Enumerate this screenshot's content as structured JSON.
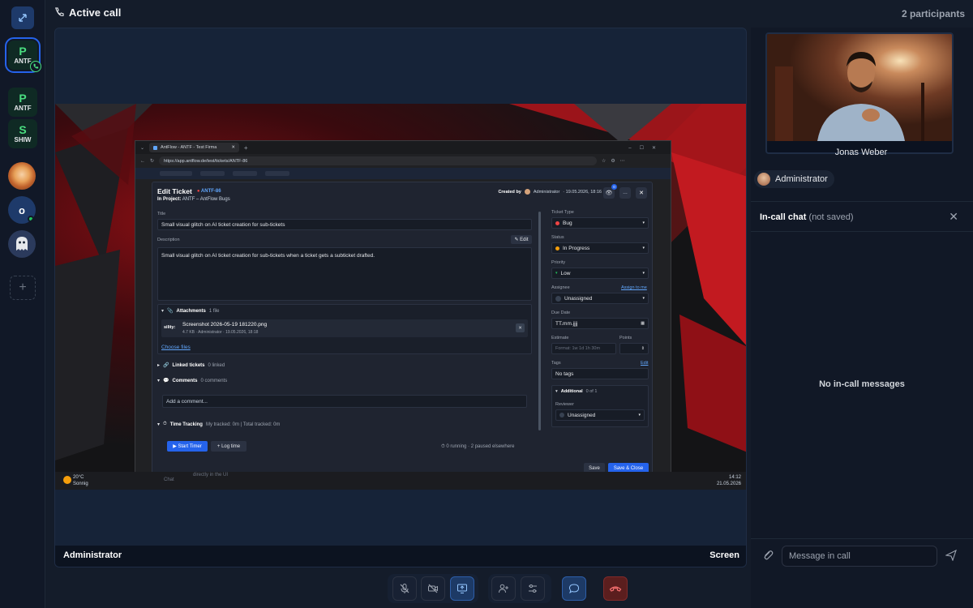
{
  "header": {
    "title": "Active call",
    "participants": "2 participants"
  },
  "rail": {
    "workspaces": [
      {
        "letter": "P",
        "code": "ANTF",
        "active": true
      },
      {
        "letter": "P",
        "code": "ANTF",
        "active": false
      },
      {
        "letter": "S",
        "code": "SHIW",
        "active": false
      }
    ],
    "add_label": "+"
  },
  "stage": {
    "presenter": "Administrator",
    "mode": "Screen"
  },
  "browser": {
    "tab_title": "AntFlow - ANTF - Test Firma",
    "url": "https://app.antflow.de/test/tickets/ANTF-86"
  },
  "ticket": {
    "heading": "Edit Ticket",
    "key": "ANTF-86",
    "project_label": "In Project:",
    "project": "ANTF – AntFlow Bugs",
    "created_by_label": "Created by",
    "created_by": "Administrator",
    "created_at": "· 19.05.2026, 18:16",
    "title_label": "Title",
    "title_value": "Small visual glitch on AI ticket creation for sub-tickets",
    "description_label": "Description",
    "edit_label": "✎ Edit",
    "description_value": "Small visual glitch on AI ticket creation for sub-tickets when a ticket gets a subticket drafted.",
    "attachments_label": "Attachments",
    "attachments_count": "1 file",
    "attachment_name": "Screenshot 2026-05-19 181220.png",
    "attachment_meta": "4.7 KB · Administrator · 19.05.2026, 18:18",
    "attachment_thumb": "sility:",
    "choose_files": "Choose files",
    "linked_label": "Linked tickets",
    "linked_count": "0 linked",
    "comments_label": "Comments",
    "comments_count": "0 comments",
    "comment_placeholder": "Add a comment...",
    "time_label": "Time Tracking",
    "time_info": "My tracked: 0m  |  Total tracked: 0m",
    "start_timer": "▶ Start Timer",
    "log_time": "+ Log time",
    "running_info": "⏱ 0 running · 2 paused elsewhere",
    "ticket_type_label": "Ticket Type",
    "ticket_type": "Bug",
    "status_label": "Status",
    "status": "In Progress",
    "priority_label": "Priority",
    "priority": "Low",
    "assignee_label": "Assignee",
    "assign_to_me": "Assign to me",
    "assignee": "Unassigned",
    "due_date_label": "Due Date",
    "due_date": "TT.mm.jjjj",
    "estimate_label": "Estimate",
    "estimate_placeholder": "Format: 1w 1d 1h 30m",
    "points_label": "Points",
    "tags_label": "Tags",
    "tags_edit": "Edit",
    "tags_value": "No tags",
    "additional_label": "Additional",
    "additional_count": "0 of 1",
    "reviewer_label": "Reviewer",
    "reviewer": "Unassigned",
    "save": "Save",
    "save_close": "Save & Close",
    "badge_count": "0"
  },
  "taskbar": {
    "weather_temp": "20°C",
    "weather_text": "Sonnig",
    "time": "14:12",
    "date": "21.05.2026",
    "chat": "Chat",
    "bg_text": "directly in the UI"
  },
  "right": {
    "participant_name": "Jonas Weber",
    "self_name": "Administrator",
    "chat_title": "In-call chat",
    "chat_note": "(not saved)",
    "empty_text": "No in-call messages",
    "input_placeholder": "Message in call"
  },
  "colors": {
    "accent": "#2563eb",
    "end_call": "#5b1e1e",
    "workspace_green": "#4ade80"
  }
}
